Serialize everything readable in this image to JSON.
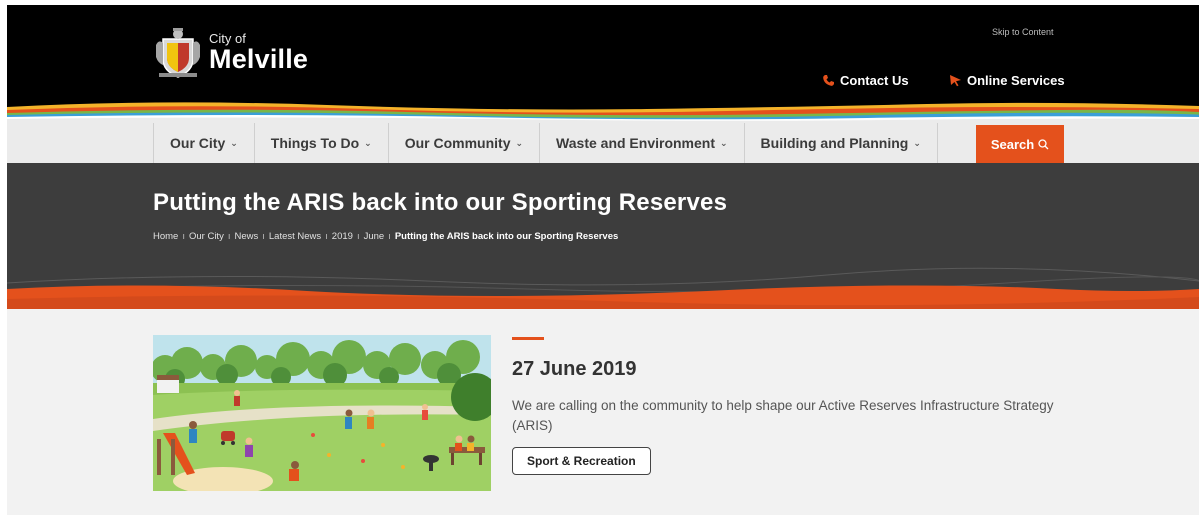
{
  "header": {
    "logo_small": "City of",
    "logo_big": "Melville",
    "skip_link": "Skip to Content",
    "contact": "Contact Us",
    "online_services": "Online Services"
  },
  "nav": {
    "items": [
      {
        "label": "Our City"
      },
      {
        "label": "Things To Do"
      },
      {
        "label": "Our Community"
      },
      {
        "label": "Waste and Environment"
      },
      {
        "label": "Building and Planning"
      }
    ],
    "search": "Search"
  },
  "banner": {
    "title": "Putting the ARIS back into our Sporting Reserves",
    "breadcrumbs": [
      "Home",
      "Our City",
      "News",
      "Latest News",
      "2019",
      "June",
      "Putting the ARIS back into our Sporting Reserves"
    ]
  },
  "article": {
    "date": "27 June 2019",
    "summary": "We are calling on the community to help shape our Active Reserves Infrastructure Strategy (ARIS)",
    "tag": "Sport & Recreation"
  },
  "colors": {
    "accent": "#e4511c",
    "header_bg": "#000000",
    "banner_bg": "#3d3d3d"
  },
  "icons": {
    "contact": "phone-icon",
    "online": "pointer-icon",
    "search": "search-icon",
    "chevron": "chevron-down-icon"
  }
}
